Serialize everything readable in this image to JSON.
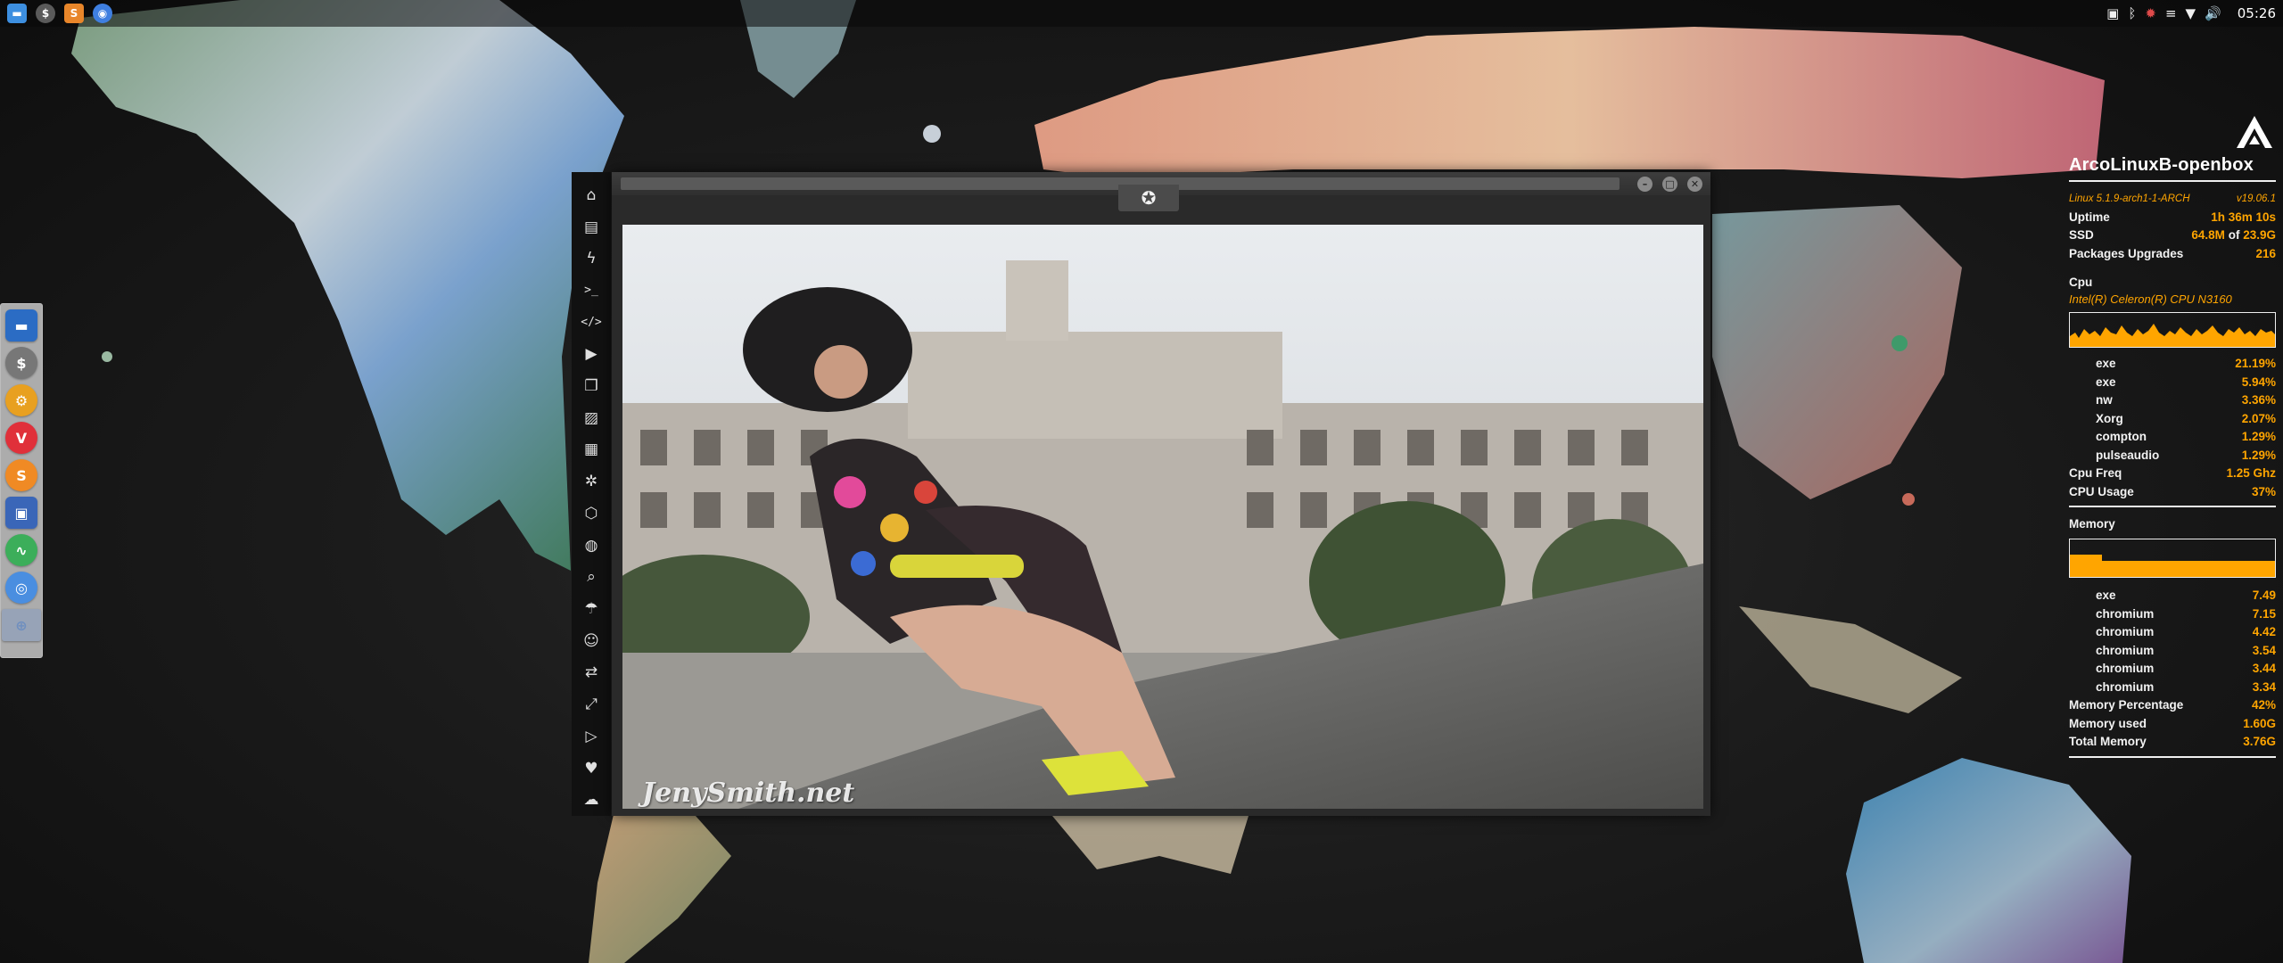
{
  "top_panel": {
    "launchers": [
      {
        "icon": "file-manager-icon",
        "color": "#3d8fe0"
      },
      {
        "icon": "mailspring-icon",
        "color": "#5a5a5a"
      },
      {
        "icon": "sublime-text-icon",
        "color": "#e8862a"
      },
      {
        "icon": "chrome-icon",
        "color": "#3f7fe0"
      }
    ],
    "tray": [
      "screenshot-icon",
      "bluetooth-icon",
      "security-icon",
      "updates-icon",
      "wifi-icon",
      "volume-icon"
    ],
    "clock": "05:26"
  },
  "dock": {
    "items": [
      {
        "name": "files",
        "icon": "file-manager-icon",
        "color": "#2b6cc4"
      },
      {
        "name": "mailspring",
        "icon": "mailspring-icon",
        "color": "#777777"
      },
      {
        "name": "transmission",
        "icon": "transmission-icon",
        "color": "#e8a020"
      },
      {
        "name": "vivaldi",
        "icon": "vivaldi-icon",
        "color": "#e0303a"
      },
      {
        "name": "sublime",
        "icon": "sublime-text-icon",
        "color": "#f08a24"
      },
      {
        "name": "screenshot",
        "icon": "screenshot-icon",
        "color": "#3a66b8"
      },
      {
        "name": "monitor",
        "icon": "system-monitor-icon",
        "color": "#3cae5a"
      },
      {
        "name": "chromium",
        "icon": "chromium-icon",
        "color": "#4a8ee0"
      },
      {
        "name": "web",
        "icon": "globe-icon",
        "color": "#6f8fbf"
      }
    ]
  },
  "app": {
    "sidebar_icons": [
      "home-icon",
      "document-icon",
      "bolt-icon",
      "terminal-icon",
      "code-icon",
      "play-icon",
      "copy-icon",
      "image-icon",
      "news-icon",
      "aperture-icon",
      "hexagon-icon",
      "globe-icon",
      "search-icon",
      "umbrella-icon",
      "contact-icon",
      "transfer-icon",
      "fullscreen-icon",
      "youtube-icon",
      "heart-icon",
      "cloud-icon"
    ],
    "watermark": "JenySmith.net"
  },
  "conky": {
    "hostname": "ArcoLinuxB-openbox",
    "kernel": "Linux 5.1.9-arch1-1-ARCH",
    "version": "v19.06.1",
    "uptime_label": "Uptime",
    "uptime": "1h 36m 10s",
    "ssd_label": "SSD",
    "ssd_used": "64.8M",
    "ssd_of": "of",
    "ssd_total": "23.9G",
    "packages_label": "Packages Upgrades",
    "packages": "216",
    "cpu_label": "Cpu",
    "cpu_model": "Intel(R) Celeron(R) CPU  N3160",
    "cpu_procs": [
      {
        "name": "exe",
        "value": "21.19%"
      },
      {
        "name": "exe",
        "value": "5.94%"
      },
      {
        "name": "nw",
        "value": "3.36%"
      },
      {
        "name": "Xorg",
        "value": "2.07%"
      },
      {
        "name": "compton",
        "value": "1.29%"
      },
      {
        "name": "pulseaudio",
        "value": "1.29%"
      }
    ],
    "cpu_freq_label": "Cpu Freq",
    "cpu_freq": "1.25 Ghz",
    "cpu_usage_label": "CPU Usage",
    "cpu_usage": "37%",
    "memory_label": "Memory",
    "memory_fraction": 0.42,
    "mem_procs": [
      {
        "name": "exe",
        "value": "7.49"
      },
      {
        "name": "chromium",
        "value": "7.15"
      },
      {
        "name": "chromium",
        "value": "4.42"
      },
      {
        "name": "chromium",
        "value": "3.54"
      },
      {
        "name": "chromium",
        "value": "3.44"
      },
      {
        "name": "chromium",
        "value": "3.34"
      }
    ],
    "mem_pct_label": "Memory Percentage",
    "mem_pct": "42%",
    "mem_used_label": "Memory used",
    "mem_used": "1.60G",
    "mem_total_label": "Total Memory",
    "mem_total": "3.76G",
    "accent": "#ffa500"
  }
}
